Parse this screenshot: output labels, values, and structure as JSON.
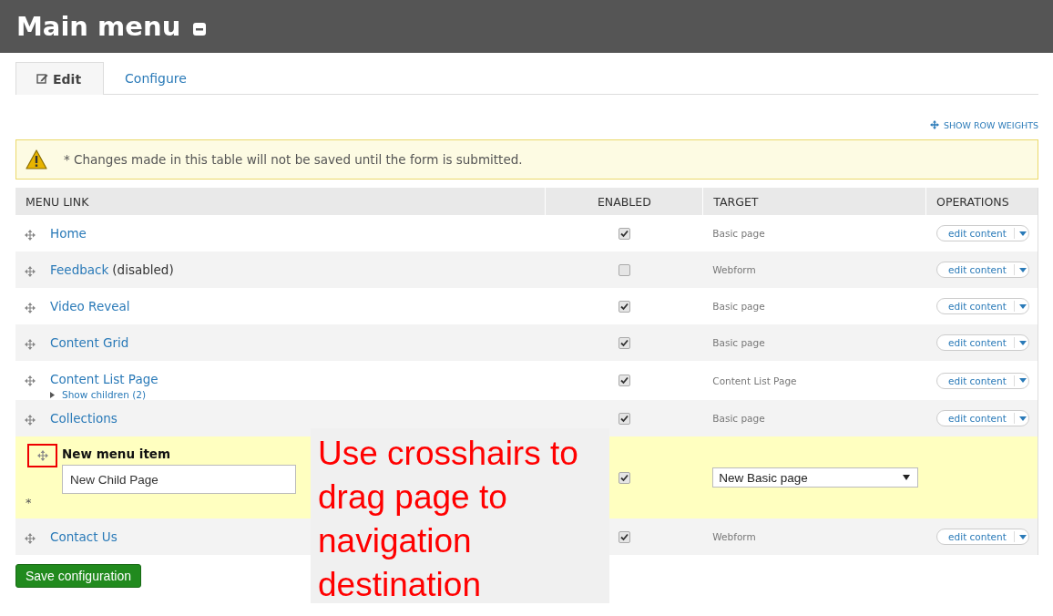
{
  "page": {
    "title": "Main menu"
  },
  "tabs": [
    {
      "label": "Edit",
      "selected": true
    },
    {
      "label": "Configure",
      "selected": false
    }
  ],
  "show_row_weights": "SHOW ROW WEIGHTS",
  "message": "* Changes made in this table will not be saved until the form is submitted.",
  "table": {
    "columns": [
      "MENU LINK",
      "ENABLED",
      "TARGET",
      "OPERATIONS"
    ],
    "rows": [
      {
        "kind": "link",
        "title": "Home",
        "enabled": true,
        "target": "Basic page",
        "operation": "edit content"
      },
      {
        "kind": "link",
        "title": "Feedback",
        "suffix": "(disabled)",
        "enabled": false,
        "target": "Webform",
        "operation": "edit content"
      },
      {
        "kind": "link",
        "title": "Video Reveal",
        "enabled": true,
        "target": "Basic page",
        "operation": "edit content"
      },
      {
        "kind": "link",
        "title": "Content Grid",
        "enabled": true,
        "target": "Basic page",
        "operation": "edit content"
      },
      {
        "kind": "link",
        "title": "Content List Page",
        "children_toggle": "Show children (2)",
        "enabled": true,
        "target": "Content List Page",
        "operation": "edit content"
      },
      {
        "kind": "link",
        "title": "Collections",
        "enabled": true,
        "target": "Basic page",
        "operation": "edit content"
      },
      {
        "kind": "new",
        "title": "New menu item",
        "value": "New Child Page",
        "marker": "*",
        "handle_highlighted": true,
        "enabled": true,
        "target": "New Basic page"
      },
      {
        "kind": "link",
        "title": "Contact Us",
        "enabled": true,
        "target": "Webform",
        "operation": "edit content"
      }
    ]
  },
  "save_button": "Save configuration",
  "annotation": "Use crosshairs to drag page to navigation destination"
}
